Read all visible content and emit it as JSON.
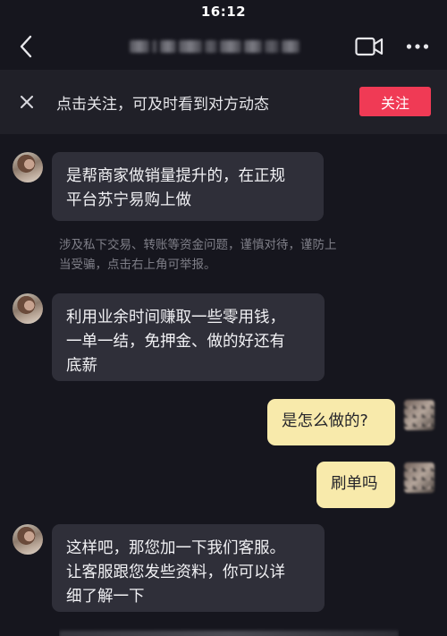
{
  "status_bar": {
    "time": "16:12"
  },
  "nav": {
    "back_icon": "chevron-left-icon",
    "video_icon": "video-camera-icon",
    "more_icon": "more-dots-icon"
  },
  "banner": {
    "close_icon": "close-icon",
    "text": "点击关注，可及时看到对方动态",
    "follow_label": "关注",
    "follow_color": "#f03a55"
  },
  "chat": {
    "messages": [
      {
        "sender": "contact",
        "text": "是帮商家做销量提升的，在正规\n平台苏宁易购上做"
      },
      {
        "sender": "contact",
        "text": "利用业余时间赚取一些零用钱，\n一单一结，免押金、做的好还有\n底薪"
      },
      {
        "sender": "self",
        "text": "是怎么做的?"
      },
      {
        "sender": "self",
        "text": "刷单吗"
      },
      {
        "sender": "contact",
        "text": "这样吧，那您加一下我们客服。\n让客服跟您发些资料，你可以详\n细了解一下"
      }
    ],
    "notice": "涉及私下交易、转账等资金问题，谨慎对待，谨防上\n当受骗，点击右上角可举报。"
  },
  "colors": {
    "background": "#16161e",
    "incoming_bubble": "#2f2f39",
    "outgoing_bubble": "#f8eaab",
    "banner_background": "#202028"
  }
}
